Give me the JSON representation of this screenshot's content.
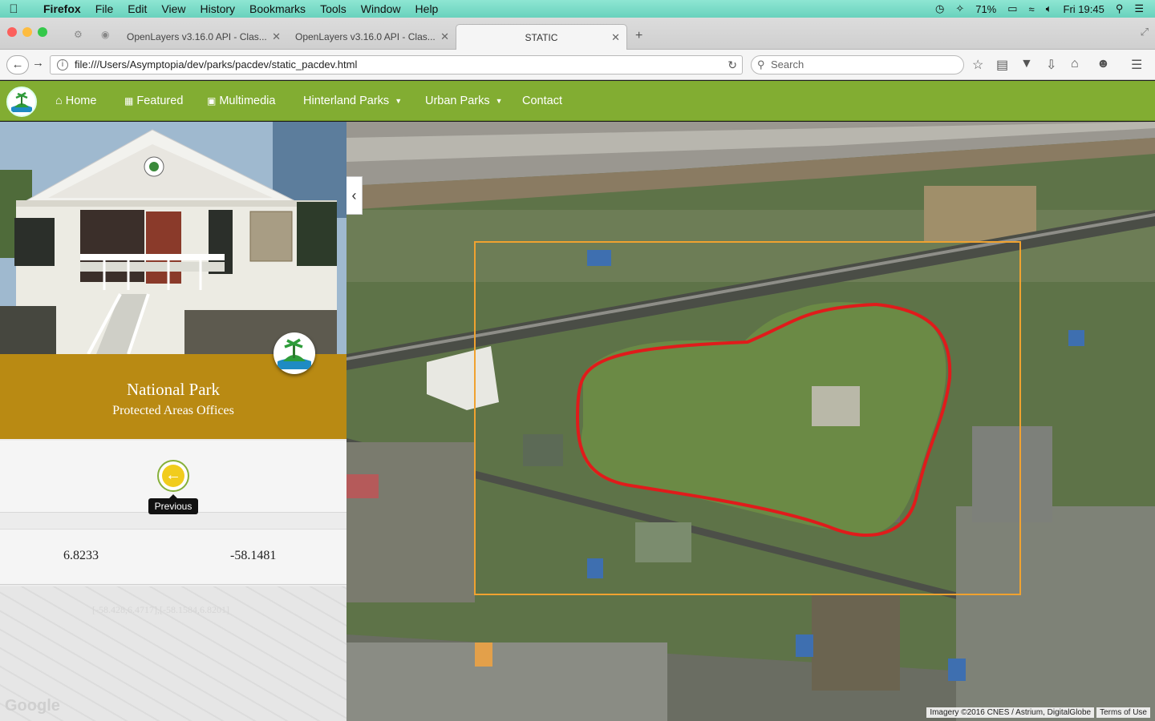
{
  "os_menubar": {
    "app_name": "Firefox",
    "menus": [
      "File",
      "Edit",
      "View",
      "History",
      "Bookmarks",
      "Tools",
      "Window",
      "Help"
    ],
    "battery": "71%",
    "clock": "Fri 19:45"
  },
  "tabs": [
    {
      "label": "OpenLayers v3.16.0 API - Clas..."
    },
    {
      "label": "OpenLayers v3.16.0 API - Clas..."
    },
    {
      "label": "STATIC"
    }
  ],
  "navigation": {
    "url": "file:///Users/Asymptopia/dev/parks/pacdev/static_pacdev.html",
    "search_placeholder": "Search"
  },
  "site_nav": {
    "items": [
      {
        "label": "Home",
        "icon": "home-icon"
      },
      {
        "label": "Featured",
        "icon": "film-icon"
      },
      {
        "label": "Multimedia",
        "icon": "picture-icon"
      },
      {
        "label": "Hinterland Parks",
        "dropdown": true
      },
      {
        "label": "Urban Parks",
        "dropdown": true
      },
      {
        "label": "Contact"
      }
    ]
  },
  "sidebar": {
    "title": "National Park",
    "subtitle": "Protected Areas Offices",
    "previous_tooltip": "Previous",
    "latitude": "6.8233",
    "longitude": "-58.1481",
    "bbox_text": "[-58.428,6.4717],[-58.1584,6.8201]",
    "map_logo": "Google"
  },
  "map": {
    "attribution": "Imagery ©2016 CNES / Astrium, DigitalGlobe",
    "terms": "Terms of Use",
    "boundary_color": "#e01b1b",
    "extent_color": "#f0a230"
  },
  "colors": {
    "nav_green": "#82ad32",
    "gold": "#b98a13"
  }
}
